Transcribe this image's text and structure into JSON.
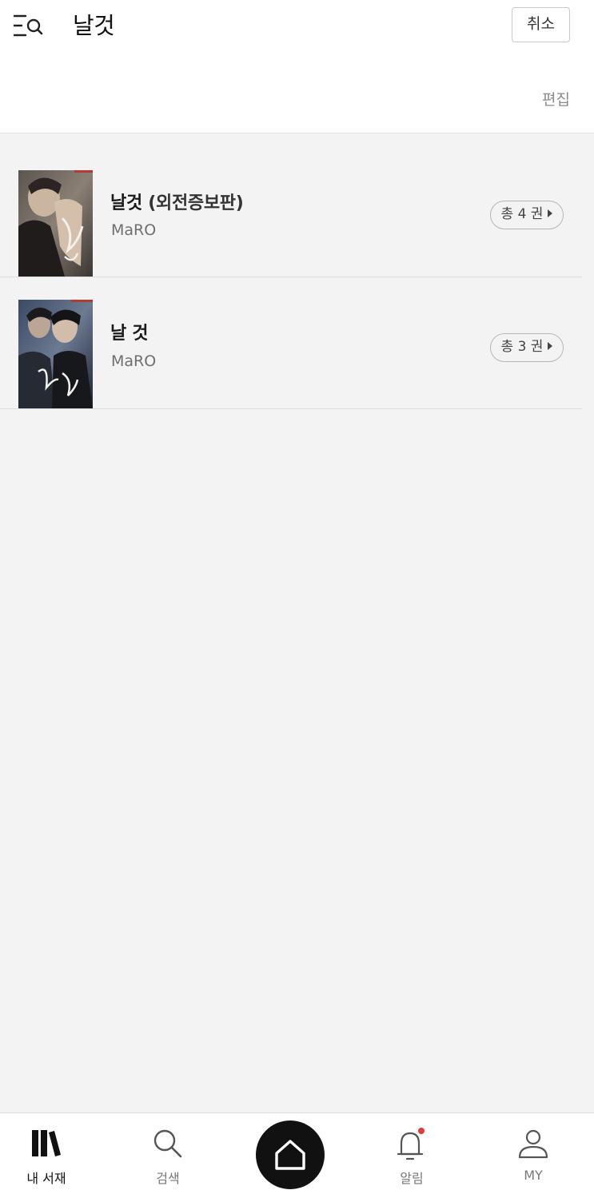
{
  "header": {
    "title": "날것",
    "cancel_label": "취소",
    "edit_label": "편집"
  },
  "books": [
    {
      "title_main": "날것",
      "title_sub": "(외전증보판)",
      "author": "MaRO",
      "volumes": "총 4 권"
    },
    {
      "title_main": "날 것",
      "title_sub": "",
      "author": "MaRO",
      "volumes": "총 3 권"
    }
  ],
  "bottom_nav": {
    "items": [
      {
        "label": "내 서재",
        "icon": "library-icon"
      },
      {
        "label": "검색",
        "icon": "search-icon"
      },
      {
        "label": "",
        "icon": "home-icon"
      },
      {
        "label": "알림",
        "icon": "bell-icon"
      },
      {
        "label": "MY",
        "icon": "person-icon"
      }
    ]
  },
  "colors": {
    "accent_dot": "#e53935",
    "background": "#f3f3f4"
  }
}
